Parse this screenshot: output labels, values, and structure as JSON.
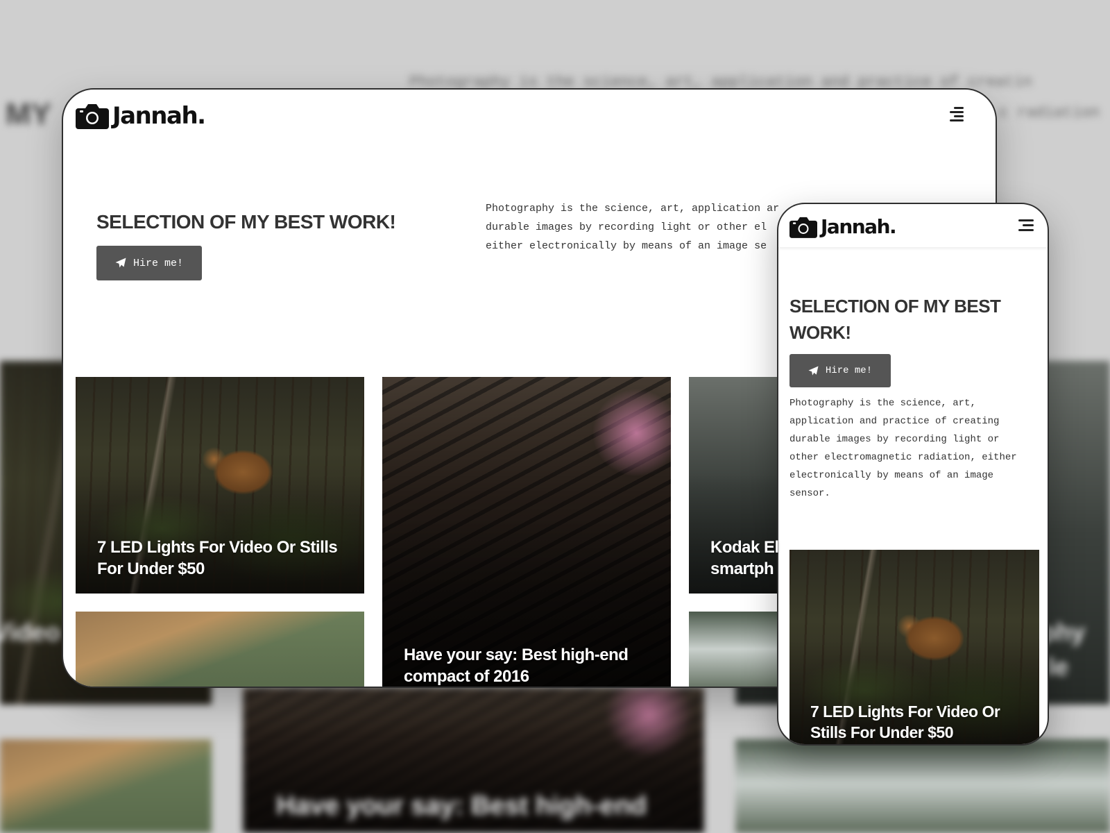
{
  "brand": {
    "name": "Jannah."
  },
  "hero": {
    "title": "SELECTION OF MY BEST WORK!",
    "title_line1": "SELECTION OF MY BEST",
    "title_line2": "WORK!",
    "button_label": "Hire me!",
    "description_desktop_line1": "Photography is the science, art, application ar",
    "description_desktop_line2": "durable images by recording light or other el",
    "description_desktop_line3": "either electronically by means of an image se",
    "description_mobile_line1": "Photography is the science, art,",
    "description_mobile_line2": "application and practice of creating",
    "description_mobile_line3": "durable images by recording light or",
    "description_mobile_line4": "other electromagnetic radiation, either",
    "description_mobile_line5": "electronically by means of an image",
    "description_mobile_line6": "sensor."
  },
  "posts": [
    {
      "line1": "7 LED Lights For Video Or Stills",
      "line2": "For Under $50"
    },
    {
      "line1": "Have your say: Best high-end",
      "line2": "compact of 2016"
    },
    {
      "line1": "Kodak El",
      "line2": "smartph"
    }
  ],
  "mobile_post": {
    "line1": "7 LED Lights For Video Or",
    "line2": "Stills For Under $50"
  },
  "background": {
    "text_line1": "Photography is the science, art, application and practice of creatin",
    "text_line2": "c radiation",
    "heading_fragment": "MY",
    "caption_left": "Video",
    "caption_center": "Have your say: Best high-end",
    "caption_right_1": "phy",
    "caption_right_2": "le"
  },
  "icons": {
    "logo": "camera-icon",
    "menu": "hamburger-menu-icon",
    "hire": "paper-plane-icon"
  },
  "colors": {
    "page_bg": "#cfcfcf",
    "button_bg": "#555555",
    "heading": "#333333",
    "frame_border": "#2f2f2f"
  }
}
